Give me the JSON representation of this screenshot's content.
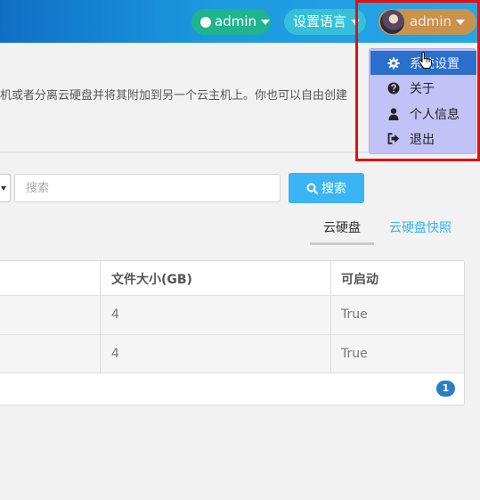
{
  "header": {
    "project_label": "admin",
    "language_label": "设置语言",
    "user_label": "admin"
  },
  "page": {
    "description": "机或者分离云硬盘并将其附加到另一个云主机上。你也可以自由创建"
  },
  "search": {
    "placeholder": "搜索",
    "button_label": "搜索"
  },
  "tabs": [
    {
      "label": "云硬盘",
      "active": true
    },
    {
      "label": "云硬盘快照",
      "active": false
    }
  ],
  "table": {
    "headers": [
      "文件大小(GB)",
      "可启动"
    ],
    "rows": [
      {
        "size": "4",
        "bootable": "True"
      },
      {
        "size": "4",
        "bootable": "True"
      }
    ],
    "page_badge": "1"
  },
  "user_menu": {
    "items": [
      {
        "label": "系统设置",
        "icon": "gear-icon"
      },
      {
        "label": "关于",
        "icon": "question-circle-icon"
      },
      {
        "label": "个人信息",
        "icon": "user-icon"
      },
      {
        "label": "退出",
        "icon": "sign-out-icon"
      }
    ]
  },
  "colors": {
    "topbar": "#1d9ae0",
    "project_pill": "#1fb48e",
    "language_pill": "#35c0d9",
    "user_pill": "#c9934e",
    "search_button": "#3ab4f2",
    "menu_bg": "#c2c2f7",
    "menu_active": "#2a6fc9",
    "highlight": "#e31010"
  }
}
